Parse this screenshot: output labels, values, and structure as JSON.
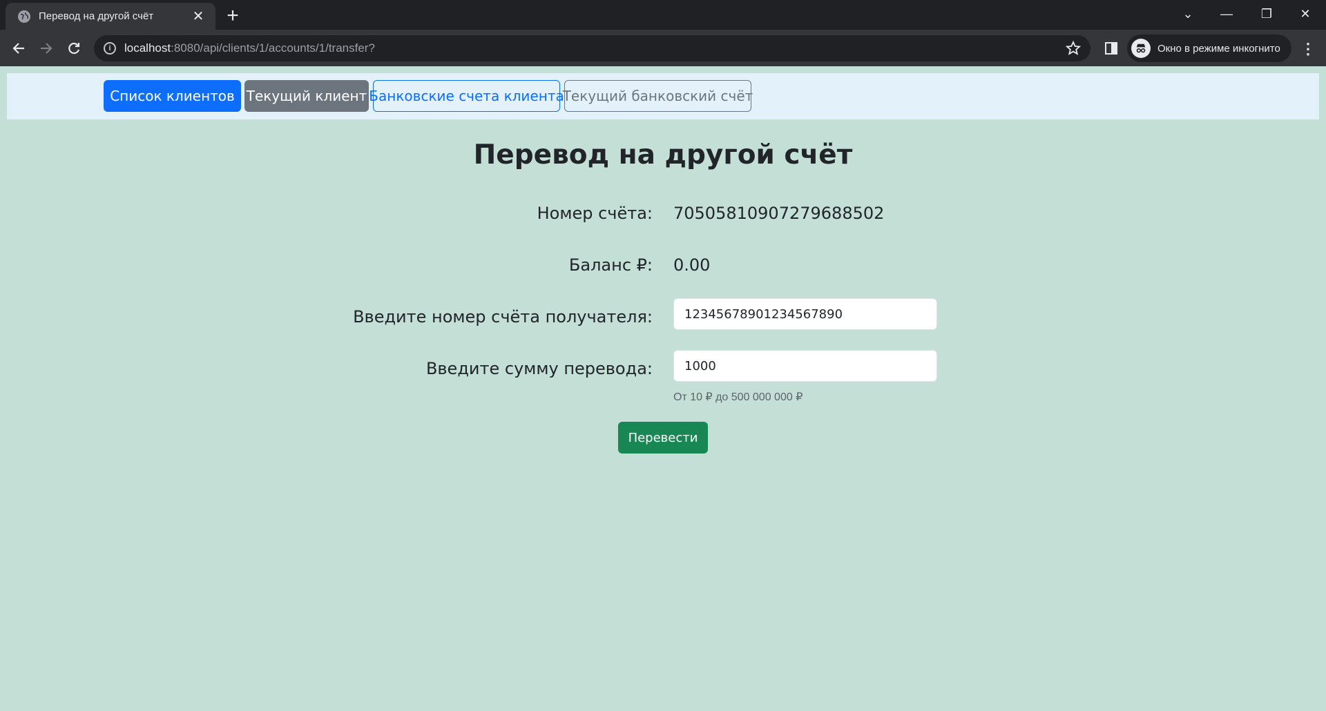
{
  "browser": {
    "tab_title": "Перевод на другой счёт",
    "tab_close": "✕",
    "new_tab": "+",
    "url_host": "localhost",
    "url_rest": ":8080/api/clients/1/accounts/1/transfer?",
    "incognito_label": "Окно в режиме инкогнито",
    "window_controls": [
      "⌄",
      "—",
      "❐",
      "✕"
    ]
  },
  "nav": {
    "clients_list": "Список клиентов",
    "current_client": "Текущий клиент",
    "client_accounts": "Банковские счета клиента",
    "current_account": "Текущий банковский счёт"
  },
  "main": {
    "title": "Перевод на другой счёт",
    "account_number_label": "Номер счёта:",
    "account_number_value": "70505810907279688502",
    "balance_label": "Баланс ₽:",
    "balance_value": "0.00",
    "recipient_label": "Введите номер счёта получателя:",
    "recipient_value": "12345678901234567890",
    "amount_label": "Введите сумму перевода:",
    "amount_value": "1000",
    "amount_hint": "От 10 ₽ до 500 000 000 ₽",
    "submit_label": "Перевести"
  },
  "colors": {
    "page_bg": "#c4e0d6",
    "navbar_bg": "#e3f1fb",
    "primary": "#0d6efd",
    "secondary": "#6c757d",
    "success": "#198754"
  }
}
